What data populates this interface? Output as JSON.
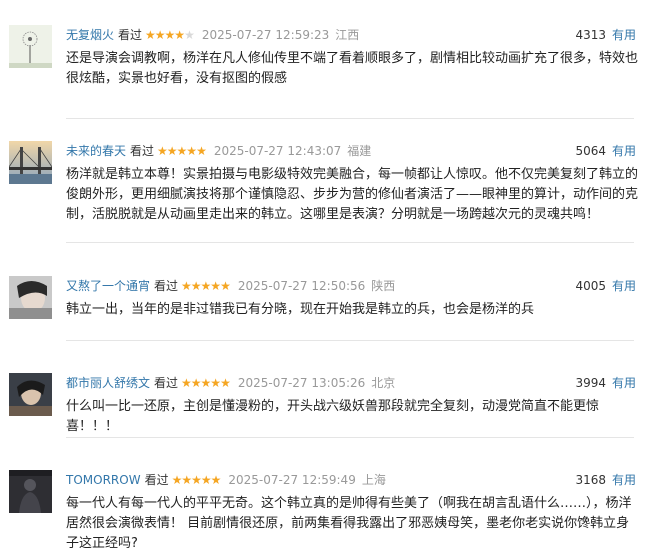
{
  "reviews": [
    {
      "username": "无复烟火",
      "watched": "看过",
      "rating": 4,
      "time": "2025-07-27 12:59:23",
      "location": "江西",
      "votes": "4313",
      "useful": "有用",
      "text": "还是导演会调教啊，杨洋在凡人修仙传里不端了看着顺眼多了，剧情相比较动画扩充了很多，特效也很炫酷，实景也好看，没有抠图的假感",
      "avatar_icon": "dandelion-avatar-icon"
    },
    {
      "username": "未来的春天",
      "watched": "看过",
      "rating": 5,
      "time": "2025-07-27 12:43:07",
      "location": "福建",
      "votes": "5064",
      "useful": "有用",
      "text": "杨洋就是韩立本尊！实景拍摄与电影级特效完美融合，每一帧都让人惊叹。他不仅完美复刻了韩立的俊朗外形，更用细腻演技将那个谨慎隐忍、步步为营的修仙者演活了——眼神里的算计，动作间的克制，活脱脱就是从动画里走出来的韩立。这哪里是表演？分明就是一场跨越次元的灵魂共鸣！",
      "avatar_icon": "bridge-avatar-icon"
    },
    {
      "username": "又熬了一个通宵",
      "watched": "看过",
      "rating": 5,
      "time": "2025-07-27 12:50:56",
      "location": "陕西",
      "votes": "4005",
      "useful": "有用",
      "text": "韩立一出，当年的是非过错我已有分晓，现在开始我是韩立的兵，也会是杨洋的兵",
      "avatar_icon": "portrait-avatar-icon"
    },
    {
      "username": "都市丽人舒绣文",
      "watched": "看过",
      "rating": 5,
      "time": "2025-07-27 13:05:26",
      "location": "北京",
      "votes": "3994",
      "useful": "有用",
      "text": "什么叫一比一还原，主创是懂漫粉的，开头战六级妖兽那段就完全复刻，动漫党简直不能更惊喜！！！",
      "avatar_icon": "portrait-avatar-icon"
    },
    {
      "username": "TOMORROW",
      "watched": "看过",
      "rating": 5,
      "time": "2025-07-27 12:59:49",
      "location": "上海",
      "votes": "3168",
      "useful": "有用",
      "text": "每一代人有每一代人的平平无奇。这个韩立真的是帅得有些美了（啊我在胡言乱语什么……），杨洋居然很会演微表情！ 目前剧情很还原，前两集看得我露出了邪恶姨母笑，墨老你老实说你馋韩立身子这正经吗?",
      "avatar_icon": "dark-figure-avatar-icon"
    }
  ],
  "colors": {
    "link": "#3377aa",
    "star": "#f5a623",
    "meta": "#999999"
  }
}
